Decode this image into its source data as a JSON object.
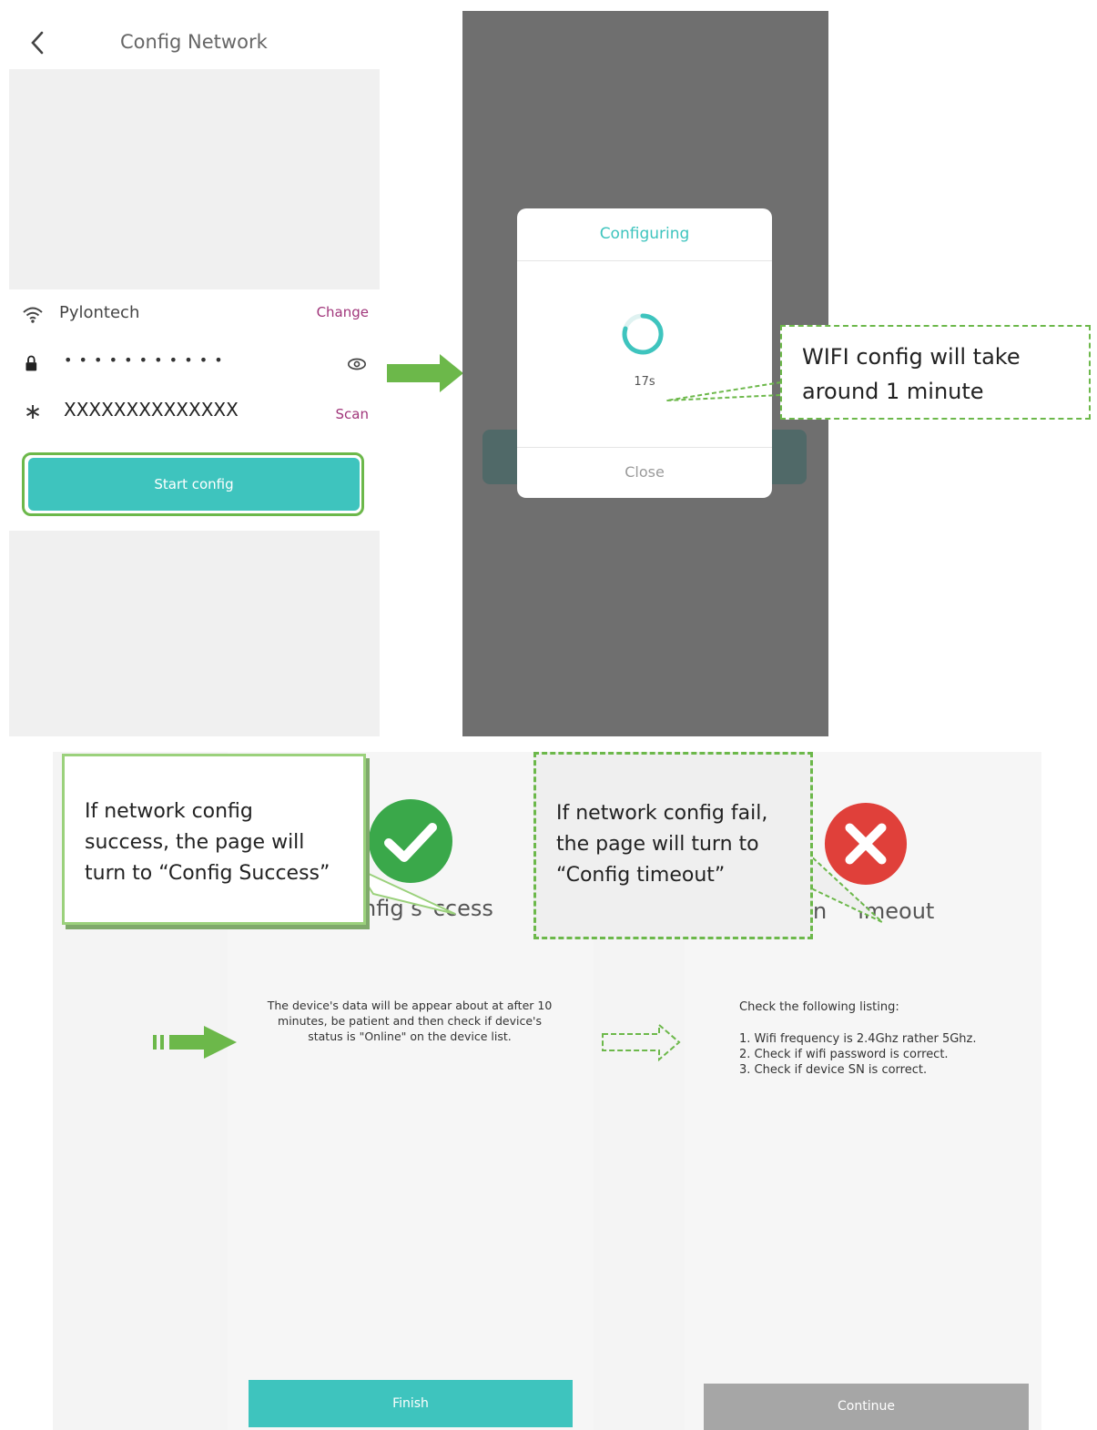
{
  "screen_config": {
    "title": "Config Network",
    "wifi_name": "Pylontech",
    "change_label": "Change",
    "password_mask": "• • • • • • • • • • •",
    "sn_value": "XXXXXXXXXXXXXX",
    "scan_label": "Scan",
    "start_button": "Start config"
  },
  "screen_configuring": {
    "modal_title": "Configuring",
    "timer": "17s",
    "close_label": "Close"
  },
  "callouts": {
    "wifi_time": [
      "WIFI config will take",
      "around 1 minute"
    ],
    "success": [
      "If network config",
      "success, the page will",
      "turn to “Config Success”"
    ],
    "fail": [
      "If network config fail,",
      "the page will turn to",
      "“Config timeout”"
    ]
  },
  "screen_success": {
    "heading_fragment_a": "nfig s",
    "heading_fragment_b": "ccess",
    "message": [
      "The device's data will be appear about at after 10",
      "minutes,  be patient and then check if device's",
      "status is \"Online\" on the device list."
    ],
    "finish_button": "Finish"
  },
  "screen_timeout": {
    "heading_fragment_a": "n",
    "heading_fragment_b": "imeout",
    "intro": "Check the following listing:",
    "checks": [
      "1. Wifi frequency is 2.4Ghz rather 5Ghz.",
      "2. Check if wifi password is correct.",
      "3. Check if device SN is correct."
    ],
    "continue_button": "Continue"
  },
  "colors": {
    "accent_teal": "#3ec4be",
    "action_magenta": "#a0357a",
    "success_green": "#3aa84a",
    "error_red": "#e0403a",
    "annotation_green": "#6cb84a",
    "overlay_gray": "#6f6f6f"
  },
  "icons": [
    "back-icon",
    "wifi-icon",
    "lock-icon",
    "eye-icon",
    "asterisk-icon",
    "spinner-icon",
    "check-circle-icon",
    "error-x-icon",
    "arrow-right-icon"
  ]
}
